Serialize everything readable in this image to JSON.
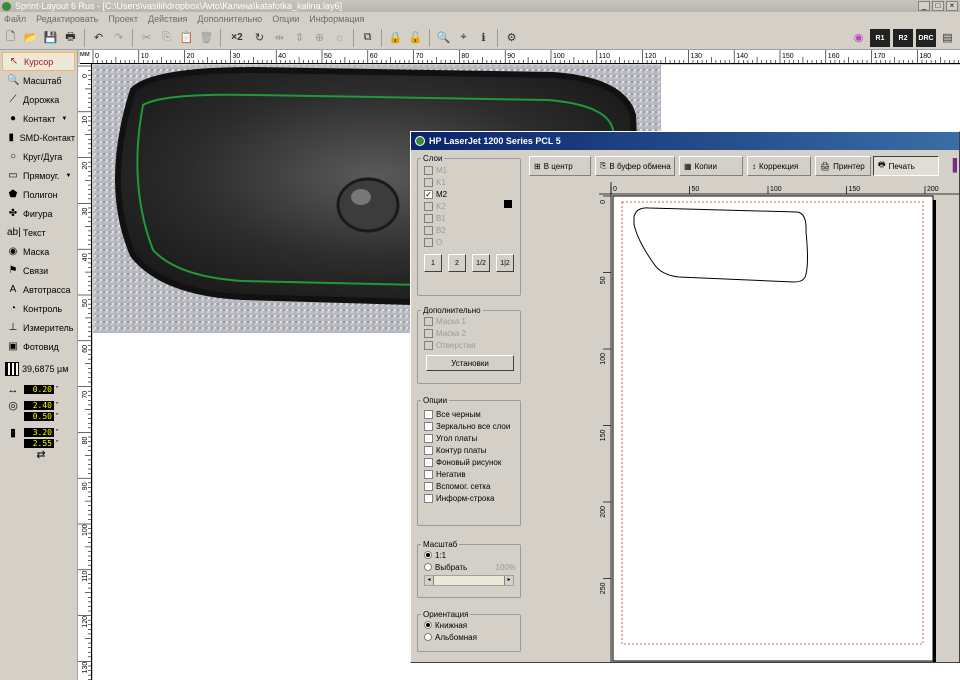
{
  "window": {
    "title": "Sprint-Layout 6 Rus - [C:\\Users\\vasilii\\dropbox\\Avto\\Калина\\katafotka_kalina.lay6]"
  },
  "menu": [
    "Файл",
    "Редактировать",
    "Проект",
    "Действия",
    "Дополнительно",
    "Опции",
    "Информация"
  ],
  "toolbar": {
    "copies_label": "×2",
    "right_labels": [
      "R1",
      "R2",
      "DRC"
    ]
  },
  "tools": [
    {
      "label": "Курсор",
      "icon": "cursor-icon",
      "glyph": "↖",
      "active": true
    },
    {
      "label": "Масштаб",
      "icon": "zoom-icon",
      "glyph": "🔍"
    },
    {
      "label": "Дорожка",
      "icon": "track-icon",
      "glyph": "⟋"
    },
    {
      "label": "Контакт",
      "icon": "pad-icon",
      "glyph": "●",
      "dropdown": true
    },
    {
      "label": "SMD-Контакт",
      "icon": "smd-pad-icon",
      "glyph": "▮"
    },
    {
      "label": "Круг/Дуга",
      "icon": "circle-icon",
      "glyph": "○"
    },
    {
      "label": "Прямоуг.",
      "icon": "rectangle-icon",
      "glyph": "▭",
      "dropdown": true
    },
    {
      "label": "Полигон",
      "icon": "polygon-icon",
      "glyph": "⬟"
    },
    {
      "label": "Фигура",
      "icon": "shape-icon",
      "glyph": "✤"
    },
    {
      "label": "Текст",
      "icon": "text-icon",
      "glyph": "ab|"
    },
    {
      "label": "Маска",
      "icon": "mask-icon",
      "glyph": "◉"
    },
    {
      "label": "Связи",
      "icon": "connections-icon",
      "glyph": "⚑"
    },
    {
      "label": "Автотрасса",
      "icon": "autoroute-icon",
      "glyph": "A"
    },
    {
      "label": "Контроль",
      "icon": "test-icon",
      "glyph": "◔"
    },
    {
      "label": "Измеритель",
      "icon": "measure-icon",
      "glyph": "⊥"
    },
    {
      "label": "Фотовид",
      "icon": "photoview-icon",
      "glyph": "▣"
    }
  ],
  "grid": {
    "value": "39,6875 µм"
  },
  "params": {
    "track_width": "0.20",
    "pad_outer": "2.40",
    "pad_inner": "0.50",
    "smd_w": "3.20",
    "smd_h": "2.55"
  },
  "ruler": {
    "unit": "мм",
    "top_ticks": [
      "0",
      "10",
      "20",
      "30",
      "40",
      "50",
      "60",
      "70",
      "80",
      "90",
      "100",
      "110",
      "120",
      "130",
      "140",
      "150",
      "160",
      "170",
      "180"
    ],
    "left_ticks": [
      "0",
      "10",
      "20",
      "30",
      "40",
      "50",
      "60",
      "70",
      "80",
      "90",
      "100",
      "110",
      "120",
      "130"
    ]
  },
  "dialog": {
    "title": "HP LaserJet 1200 Series PCL 5",
    "tools": [
      {
        "label": "В центр",
        "icon": "center-icon",
        "glyph": "⊞"
      },
      {
        "label": "В буфер обмена",
        "icon": "clipboard-icon",
        "glyph": "⎘"
      },
      {
        "label": "Копии",
        "icon": "copies-icon",
        "glyph": "▦"
      },
      {
        "label": "Коррекция",
        "icon": "correction-icon",
        "glyph": "↕"
      },
      {
        "label": "Принтер",
        "icon": "printer-setup-icon",
        "glyph": "🖨"
      },
      {
        "label": "Печать",
        "icon": "print-icon",
        "glyph": "🖶",
        "pressed": true
      }
    ],
    "layers": {
      "legend": "Слои",
      "items": [
        {
          "label": "M1",
          "checked": false,
          "disabled": true
        },
        {
          "label": "K1",
          "checked": false,
          "disabled": true
        },
        {
          "label": "M2",
          "checked": true,
          "disabled": false
        },
        {
          "label": "K2",
          "checked": false,
          "disabled": true
        },
        {
          "label": "B1",
          "checked": false,
          "disabled": true
        },
        {
          "label": "B2",
          "checked": false,
          "disabled": true
        },
        {
          "label": "O",
          "checked": false,
          "disabled": true
        }
      ],
      "side_buttons": [
        "1",
        "2",
        "1/2",
        "1|2"
      ]
    },
    "extra": {
      "legend": "Дополнительно",
      "items": [
        "Маска 1",
        "Маска 2",
        "Отверстия"
      ],
      "setup_button": "Установки"
    },
    "options": {
      "legend": "Опции",
      "items": [
        "Все черным",
        "Зеркально все слои",
        "Угол платы",
        "Контур платы",
        "Фоновый рисунок",
        "Негатив",
        "Вспомог. сетка",
        "Информ-строка"
      ]
    },
    "scale": {
      "legend": "Масштаб",
      "opt1": "1:1",
      "opt2": "Выбрать",
      "percent": "100%",
      "selected": "1:1"
    },
    "orientation": {
      "legend": "Ориентация",
      "opt1": "Книжная",
      "opt2": "Альбомная",
      "selected": "Книжная"
    },
    "preview": {
      "top_ticks": [
        "0",
        "50",
        "100",
        "150",
        "200"
      ],
      "left_ticks": [
        "0",
        "50",
        "100",
        "150",
        "200",
        "250"
      ]
    }
  },
  "colors": {
    "active_tool": "#b0191e",
    "dialog_title": "#0a246a",
    "param_text": "#ffff00",
    "outline": "#1e9a3c"
  }
}
